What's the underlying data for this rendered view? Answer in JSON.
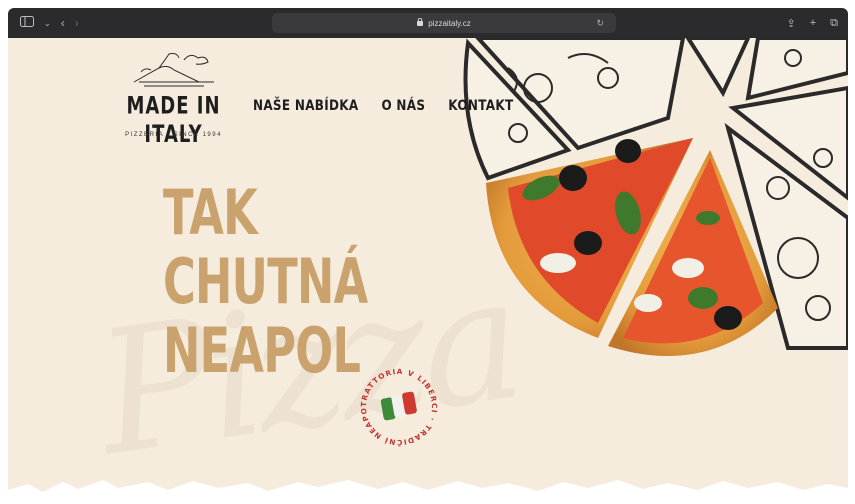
{
  "browser": {
    "url": "pizzaitaly.cz",
    "lock_icon": "lock-icon",
    "sidebar_icon": "sidebar-icon",
    "back_icon": "chevron-left-icon",
    "forward_icon": "chevron-right-icon",
    "reload_icon": "reload-icon",
    "share_icon": "share-icon",
    "new_tab_icon": "plus-icon",
    "tabs_icon": "tabs-icon"
  },
  "logo": {
    "main": "MADE IN ITALY",
    "sub": "PIZZERIA · SINCE 1994"
  },
  "nav": {
    "items": [
      "NAŠE NABÍDKA",
      "O NÁS",
      "KONTAKT"
    ]
  },
  "hero": {
    "line1": "TAK",
    "line2": "CHUTNÁ",
    "line3": "NEAPOL"
  },
  "badge": {
    "text": "TRATTORIA V LIBERCI · TRADIČNÍ NEAPOLSKÁ ·"
  },
  "watermark": "Pizza",
  "colors": {
    "background": "#f5ecdd",
    "accent": "#c9a26d",
    "text": "#1e1e1e",
    "badge_red": "#c2332e"
  }
}
